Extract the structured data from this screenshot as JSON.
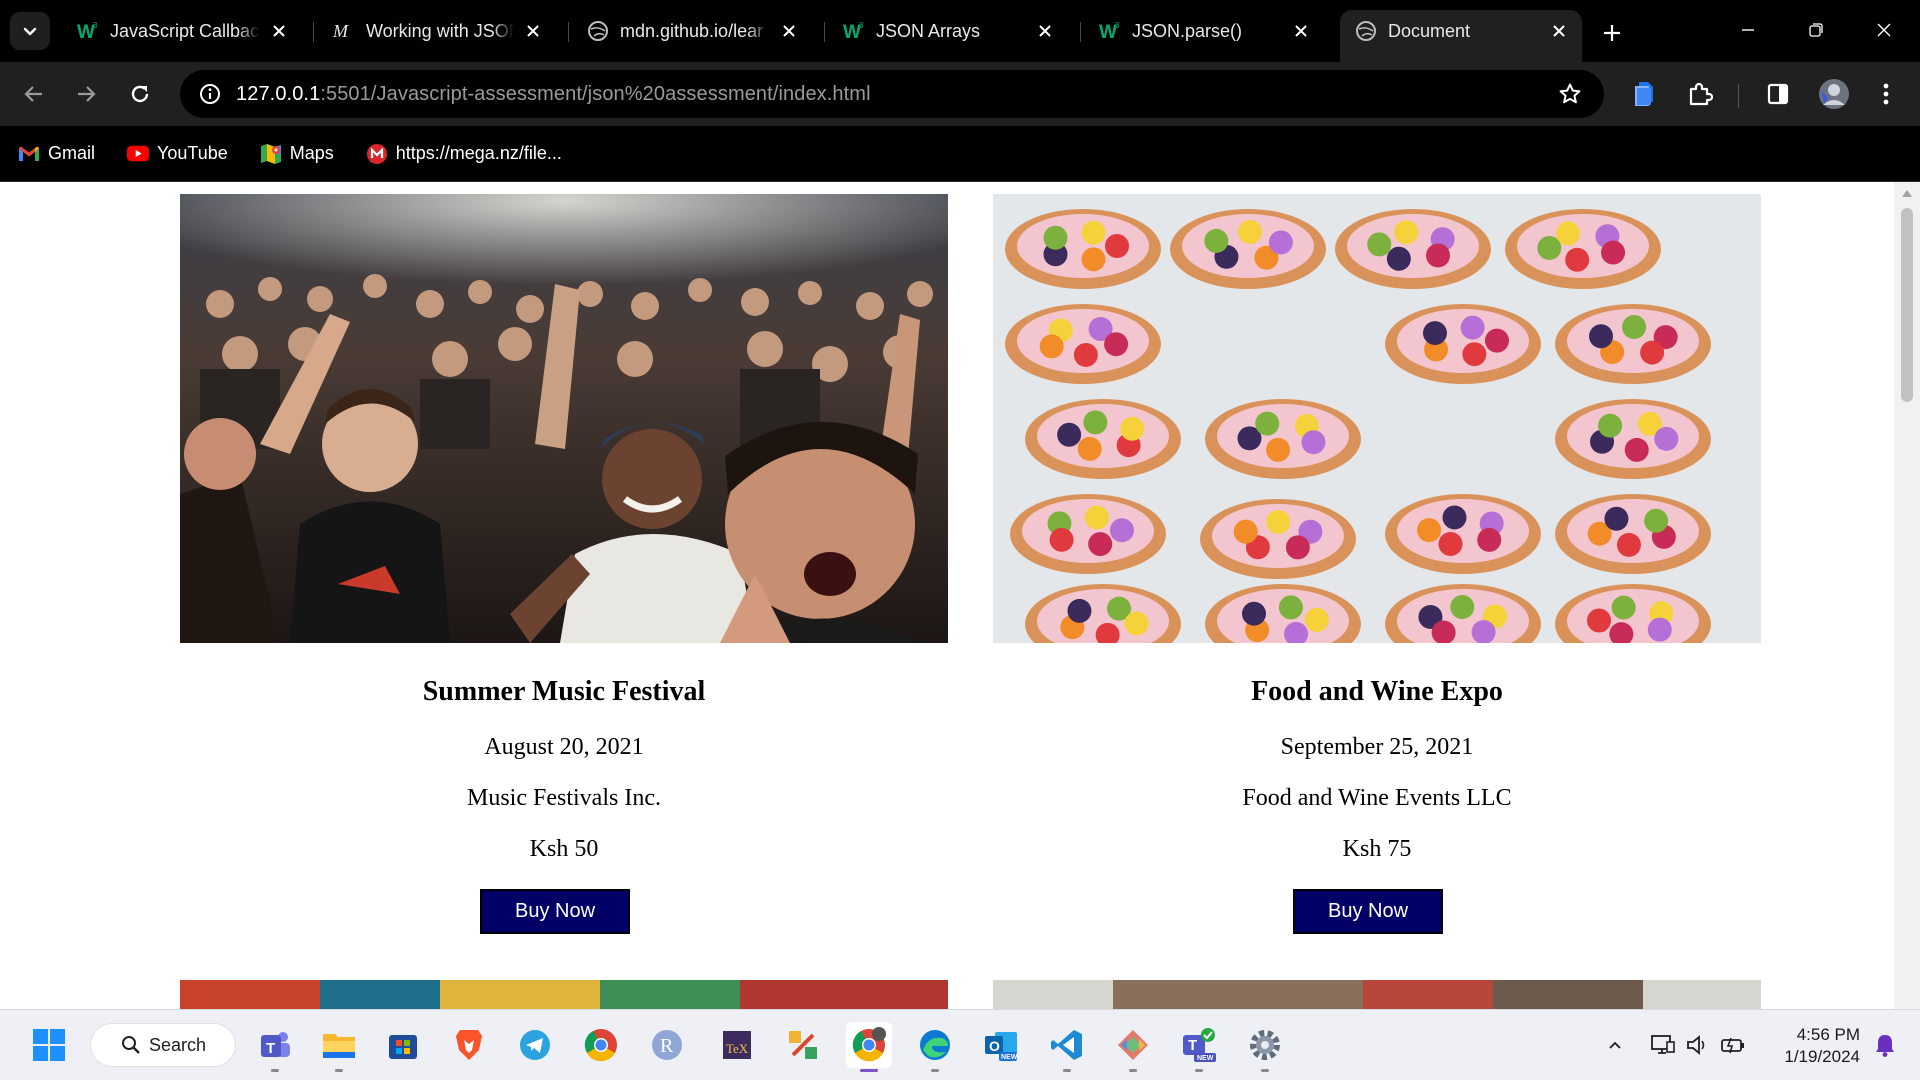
{
  "browser": {
    "tabs": [
      {
        "title": "JavaScript Callback",
        "favicon": "w3schools-icon"
      },
      {
        "title": "Working with JSON",
        "favicon": "mdn-icon"
      },
      {
        "title": "mdn.github.io/lear",
        "favicon": "globe-icon"
      },
      {
        "title": "JSON Arrays",
        "favicon": "w3schools-icon"
      },
      {
        "title": "JSON.parse()",
        "favicon": "w3schools-icon"
      },
      {
        "title": "Document",
        "favicon": "globe-icon",
        "active": true
      }
    ],
    "url_host": "127.0.0.1",
    "url_rest": ":5501/Javascript-assessment/json%20assessment/index.html",
    "bookmarks": [
      {
        "label": "Gmail",
        "icon": "gmail-icon"
      },
      {
        "label": "YouTube",
        "icon": "youtube-icon"
      },
      {
        "label": "Maps",
        "icon": "maps-icon"
      },
      {
        "label": "https://mega.nz/file...",
        "icon": "mega-icon"
      }
    ]
  },
  "events": [
    {
      "name": "Summer Music Festival",
      "date": "August 20, 2021",
      "organizer": "Music Festivals Inc.",
      "price": "Ksh 50",
      "button": "Buy Now",
      "image": "concert-crowd-photo"
    },
    {
      "name": "Food and Wine Expo",
      "date": "September 25, 2021",
      "organizer": "Food and Wine Events LLC",
      "price": "Ksh 75",
      "button": "Buy Now",
      "image": "fruit-tarts-photo"
    }
  ],
  "colors": {
    "buy_button": "#000066",
    "chrome_bg": "#000000",
    "toolbar_bg": "#202020"
  },
  "taskbar": {
    "search_label": "Search",
    "apps": [
      "teams-icon",
      "file-explorer-icon",
      "microsoft-store-icon",
      "brave-icon",
      "telegram-icon",
      "chrome-icon",
      "r-icon",
      "texstudio-icon",
      "app-icon",
      "chrome-profile-icon",
      "edge-icon",
      "outlook-icon",
      "vscode-icon",
      "git-icon",
      "teams-new-icon",
      "settings-icon"
    ],
    "time": "4:56 PM",
    "date": "1/19/2024"
  }
}
